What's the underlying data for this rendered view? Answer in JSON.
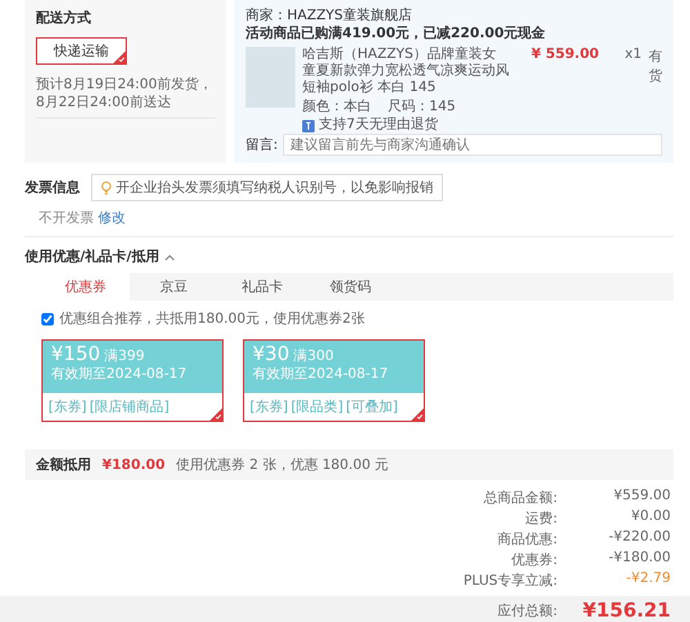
{
  "shipping": {
    "title": "配送方式",
    "options": [
      {
        "label": "快递运输",
        "selected": true
      }
    ],
    "estimate": "预计8月19日24:00前发货，8月22日24:00前送达"
  },
  "order": {
    "shop": "商家：HAZZYS童装旗舰店",
    "promo": "活动商品已购满419.00元，已减220.00元现金",
    "item": {
      "title": "哈吉斯（HAZZYS）品牌童装女童夏新款弹力宽松透气凉爽运动风短袖polo衫 本白 145",
      "price": "¥ 559.00",
      "qty": "x1",
      "stock": "有货",
      "spec_colour": "颜色：本白",
      "size": "尺码：145",
      "service": "支持7天无理由退货"
    },
    "note": {
      "label": "留言:",
      "placeholder": "建议留言前先与商家沟通确认"
    }
  },
  "invoice": {
    "title": "发票信息",
    "tip": "开企业抬头发票须填写纳税人识别号，以免影响报销",
    "status": "不开发票",
    "edit": "修改"
  },
  "discounts": {
    "title": "使用优惠/礼品卡/抵用",
    "expanded": true,
    "tabs": [
      {
        "label": "优惠券",
        "selected": true
      },
      {
        "label": "京豆",
        "selected": false
      },
      {
        "label": "礼品卡",
        "selected": false
      },
      {
        "label": "领货码",
        "selected": false
      }
    ],
    "recommend": {
      "checked": true,
      "label": "优惠组合推荐，共抵用180.00元，使用优惠券2张"
    },
    "coupons": [
      {
        "amount": "¥150",
        "condition": "满399",
        "validity": "有效期至2024-08-17",
        "tags": [
          "[东券]",
          "[限店铺商品]"
        ],
        "selected": true
      },
      {
        "amount": "¥30",
        "condition": "满300",
        "validity": "有效期至2024-08-17",
        "tags": [
          "[东券]",
          "[限品类]",
          "[可叠加]"
        ],
        "selected": true
      }
    ],
    "total_label": "金额抵用",
    "total_value": "¥180.00",
    "total_note": "使用优惠券 2 张，优惠 180.00 元"
  },
  "summary": {
    "rows": [
      {
        "label": "总商品金额:",
        "value": "¥559.00",
        "kind": "normal"
      },
      {
        "label": "运费:",
        "value": "¥0.00",
        "kind": "normal"
      },
      {
        "label": "商品优惠:",
        "value": "-¥220.00",
        "kind": "normal"
      },
      {
        "label": "优惠券:",
        "value": "-¥180.00",
        "kind": "normal"
      },
      {
        "label": "PLUS专享立减:",
        "value": "-¥2.79",
        "kind": "plus"
      }
    ],
    "payable_label": "应付总额:",
    "payable_value": "¥156.21"
  }
}
